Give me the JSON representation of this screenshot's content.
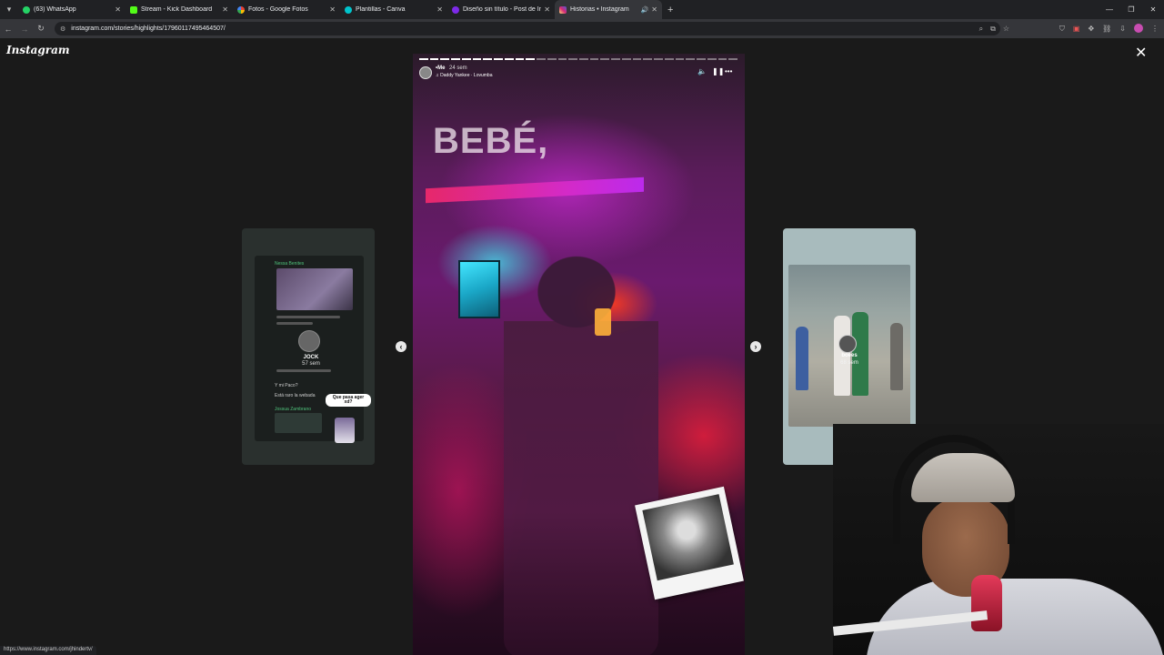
{
  "browser": {
    "tabs": [
      {
        "title": "(63) WhatsApp",
        "color": "#25d366",
        "active": false
      },
      {
        "title": "Stream - Kick Dashboard",
        "color": "#53fc18",
        "active": false
      },
      {
        "title": "Fotos - Google Fotos",
        "color": "#fbbc04",
        "active": false
      },
      {
        "title": "Plantillas - Canva",
        "color": "#00c4cc",
        "active": false
      },
      {
        "title": "Diseño sin título - Post de Instag",
        "color": "#7d2ae8",
        "active": false
      },
      {
        "title": "Historias • Instagram",
        "color": "#e1306c",
        "active": true
      }
    ],
    "url": "instagram.com/stories/highlights/17960117495464507/",
    "status_url": "https://www.instagram.com/jhindertv/"
  },
  "page": {
    "logo": "Instagram",
    "close_icon": "close-icon"
  },
  "story": {
    "username": "•Me",
    "time": "24 sem",
    "music": "Daddy Yankee · Lovumba",
    "overlay_text": "BEBÉ,",
    "segments_total": 30,
    "segments_done": 11
  },
  "preview_left": {
    "chat_name": "Nessa Benites",
    "user": "JOCK",
    "time": "57 sem",
    "line1": "Y mi Paco?",
    "line2": "Está raro la webada",
    "bubble": "Que pasa ager xd?",
    "chat_name2": "Jossua Zambrano"
  },
  "preview_right": {
    "user": "boees",
    "time": "68 sem",
    "emoji": "🍃🔥",
    "top_emoji": "🔥🍃"
  }
}
